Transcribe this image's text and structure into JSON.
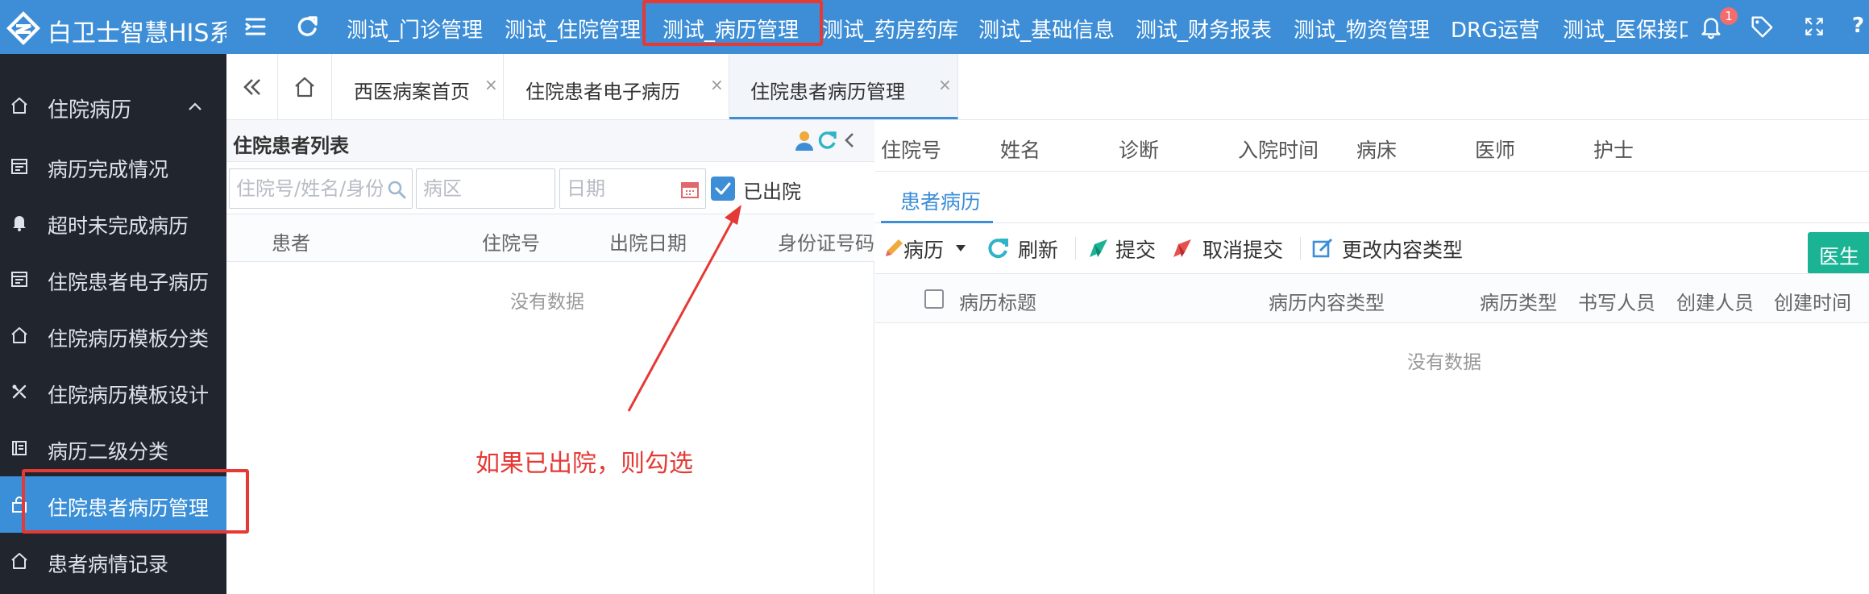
{
  "app": {
    "title": "白卫士智慧HIS系统"
  },
  "modules": [
    {
      "label": "测试_门诊管理"
    },
    {
      "label": "测试_住院管理"
    },
    {
      "label": "测试_病历管理"
    },
    {
      "label": "测试_药房药库"
    },
    {
      "label": "测试_基础信息"
    },
    {
      "label": "测试_财务报表"
    },
    {
      "label": "测试_物资管理"
    },
    {
      "label": "DRG运营"
    },
    {
      "label": "测试_医保接口"
    }
  ],
  "topbar": {
    "notification_count": "1",
    "help_glyph": "?"
  },
  "sidebar": {
    "group_label": "住院病历",
    "items": [
      {
        "label": "病历完成情况",
        "icon": "calendar-icon"
      },
      {
        "label": "超时未完成病历",
        "icon": "bell-icon"
      },
      {
        "label": "住院患者电子病历",
        "icon": "calendar-icon"
      },
      {
        "label": "住院病历模板分类",
        "icon": "home-icon"
      },
      {
        "label": "住院病历模板设计",
        "icon": "tools-icon"
      },
      {
        "label": "病历二级分类",
        "icon": "book-icon"
      },
      {
        "label": "住院患者病历管理",
        "icon": "lock-icon"
      },
      {
        "label": "患者病情记录",
        "icon": "home-icon"
      }
    ]
  },
  "tabs": [
    {
      "label": "西医病案首页",
      "close": "×"
    },
    {
      "label": "住院患者电子病历",
      "close": "×"
    },
    {
      "label": "住院患者病历管理",
      "close": "×"
    }
  ],
  "patient_list": {
    "title": "住院患者列表",
    "search_placeholder": "住院号/姓名/身份证号",
    "ward_placeholder": "病区",
    "date_placeholder": "日期",
    "discharged_label": "已出院",
    "columns": [
      "患者",
      "住院号",
      "出院日期",
      "身份证号码"
    ],
    "empty_text": "没有数据"
  },
  "annotation": {
    "text": "如果已出院，则勾选"
  },
  "patient_info": {
    "labels": [
      "住院号",
      "姓名",
      "诊断",
      "入院时间",
      "病床",
      "医师",
      "护士"
    ]
  },
  "record_tab": {
    "label": "患者病历"
  },
  "toolbar": {
    "record_menu": "病历",
    "refresh": "刷新",
    "submit": "提交",
    "cancel_submit": "取消提交",
    "change_type": "更改内容类型",
    "doctor": "医生"
  },
  "records": {
    "columns": [
      "病历标题",
      "病历内容类型",
      "病历类型",
      "书写人员",
      "创建人员",
      "创建时间"
    ],
    "empty_text": "没有数据"
  },
  "colors": {
    "accent": "#3d8ed7",
    "sidebar_bg": "#20252e",
    "highlight": "#e53935",
    "doctor_btn": "#1ab394"
  }
}
